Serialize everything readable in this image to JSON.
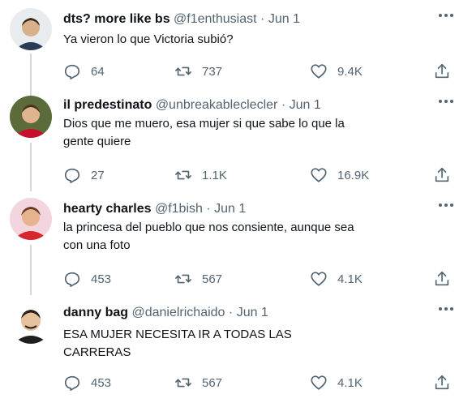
{
  "tweets": [
    {
      "name": "dts? more like bs",
      "handle": "@f1enthusiast",
      "separator": "·",
      "date": "Jun 1",
      "text_lines": [
        "Ya vieron lo que Victoria subió?"
      ],
      "replies": "64",
      "retweets": "737",
      "likes": "9.4K",
      "avatar_colors": {
        "bg": "#e9ecef",
        "skin": "#d8b08c",
        "hair": "#3a2a1e",
        "shirt": "#2b3a55"
      }
    },
    {
      "name": "il predestinato",
      "handle": "@unbreakableclecler",
      "separator": "·",
      "date": "Jun 1",
      "text_lines": [
        "Dios que me muero, esa mujer si que sabe lo que la",
        "gente quiere"
      ],
      "replies": "27",
      "retweets": "1.1K",
      "likes": "16.9K",
      "avatar_colors": {
        "bg": "#5b6b3a",
        "skin": "#e0b48e",
        "hair": "#4a3020",
        "shirt": "#c8102e"
      }
    },
    {
      "name": "hearty charles",
      "handle": "@f1bish",
      "separator": "·",
      "date": "Jun 1",
      "text_lines": [
        "la princesa del pueblo que nos consiente, aunque sea",
        "con una foto"
      ],
      "replies": "453",
      "retweets": "567",
      "likes": "4.1K",
      "avatar_colors": {
        "bg": "#f3d5df",
        "skin": "#e5b48f",
        "hair": "#6a3a22",
        "shirt": "#d7262e"
      }
    },
    {
      "name": "danny bag",
      "handle": "@danielrichaido",
      "separator": "·",
      "date": "Jun 1",
      "text_lines": [
        "ESA MUJER NECESITA IR A TODAS LAS",
        "CARRERAS"
      ],
      "replies": "453",
      "retweets": "567",
      "likes": "4.1K",
      "avatar_colors": {
        "bg": "#ffffff",
        "skin": "#e6c1a0",
        "hair": "#2a1d14",
        "shirt": "#1f1f1f"
      }
    }
  ],
  "icons": {
    "reply": "reply-icon",
    "retweet": "retweet-icon",
    "like": "heart-icon",
    "share": "share-icon",
    "more": "more-icon"
  },
  "colors": {
    "muted": "#536471",
    "text": "#0f1419",
    "line": "#cfd9de"
  }
}
